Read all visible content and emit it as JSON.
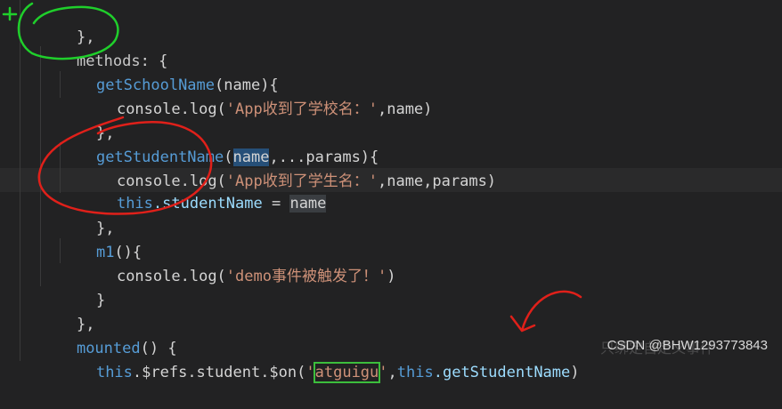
{
  "code": {
    "line1": "},",
    "line2_key": "methods",
    "line2_rest": ": {",
    "line3_fn": "getSchoolName",
    "line3_args": "(name){",
    "line4_obj": "console",
    "line4_call": ".log(",
    "line4_str": "'App收到了学校名：'",
    "line4_rest": ",name)",
    "line5": "},",
    "line6_fn": "getStudentName",
    "line6_open": "(",
    "line6_param": "name",
    "line6_rest": ",...params){",
    "line7_obj": "console",
    "line7_call": ".log(",
    "line7_str": "'App收到了学生名：'",
    "line7_rest": ",name,params)",
    "line8_this": "this",
    "line8_prop": ".studentName",
    "line8_eq": " = ",
    "line8_val": "name",
    "line9": "},",
    "line10_fn": "m1",
    "line10_rest": "(){",
    "line11_obj": "console",
    "line11_call": ".log(",
    "line11_str": "'demo事件被触发了！'",
    "line11_rest": ")",
    "line12": "}",
    "line13": "},",
    "line14_fn": "mounted",
    "line14_rest": "() {",
    "line15_this": "this",
    "line15_refs": ".$refs.student.$on(",
    "line15_q1": "'",
    "line15_str": "atguigu",
    "line15_q2": "'",
    "line15_comma": ",",
    "line15_this2": "this",
    "line15_prop": ".getStudentName",
    "line15_end": ")"
  },
  "watermark": "CSDN @BHW1293773843",
  "ghost_text": "只绑定自定义事件",
  "colors": {
    "background": "#222223",
    "keyword": "#569cd6",
    "string": "#ce9178",
    "annotation_green": "#1fcf2b",
    "annotation_red": "#e0201a"
  }
}
